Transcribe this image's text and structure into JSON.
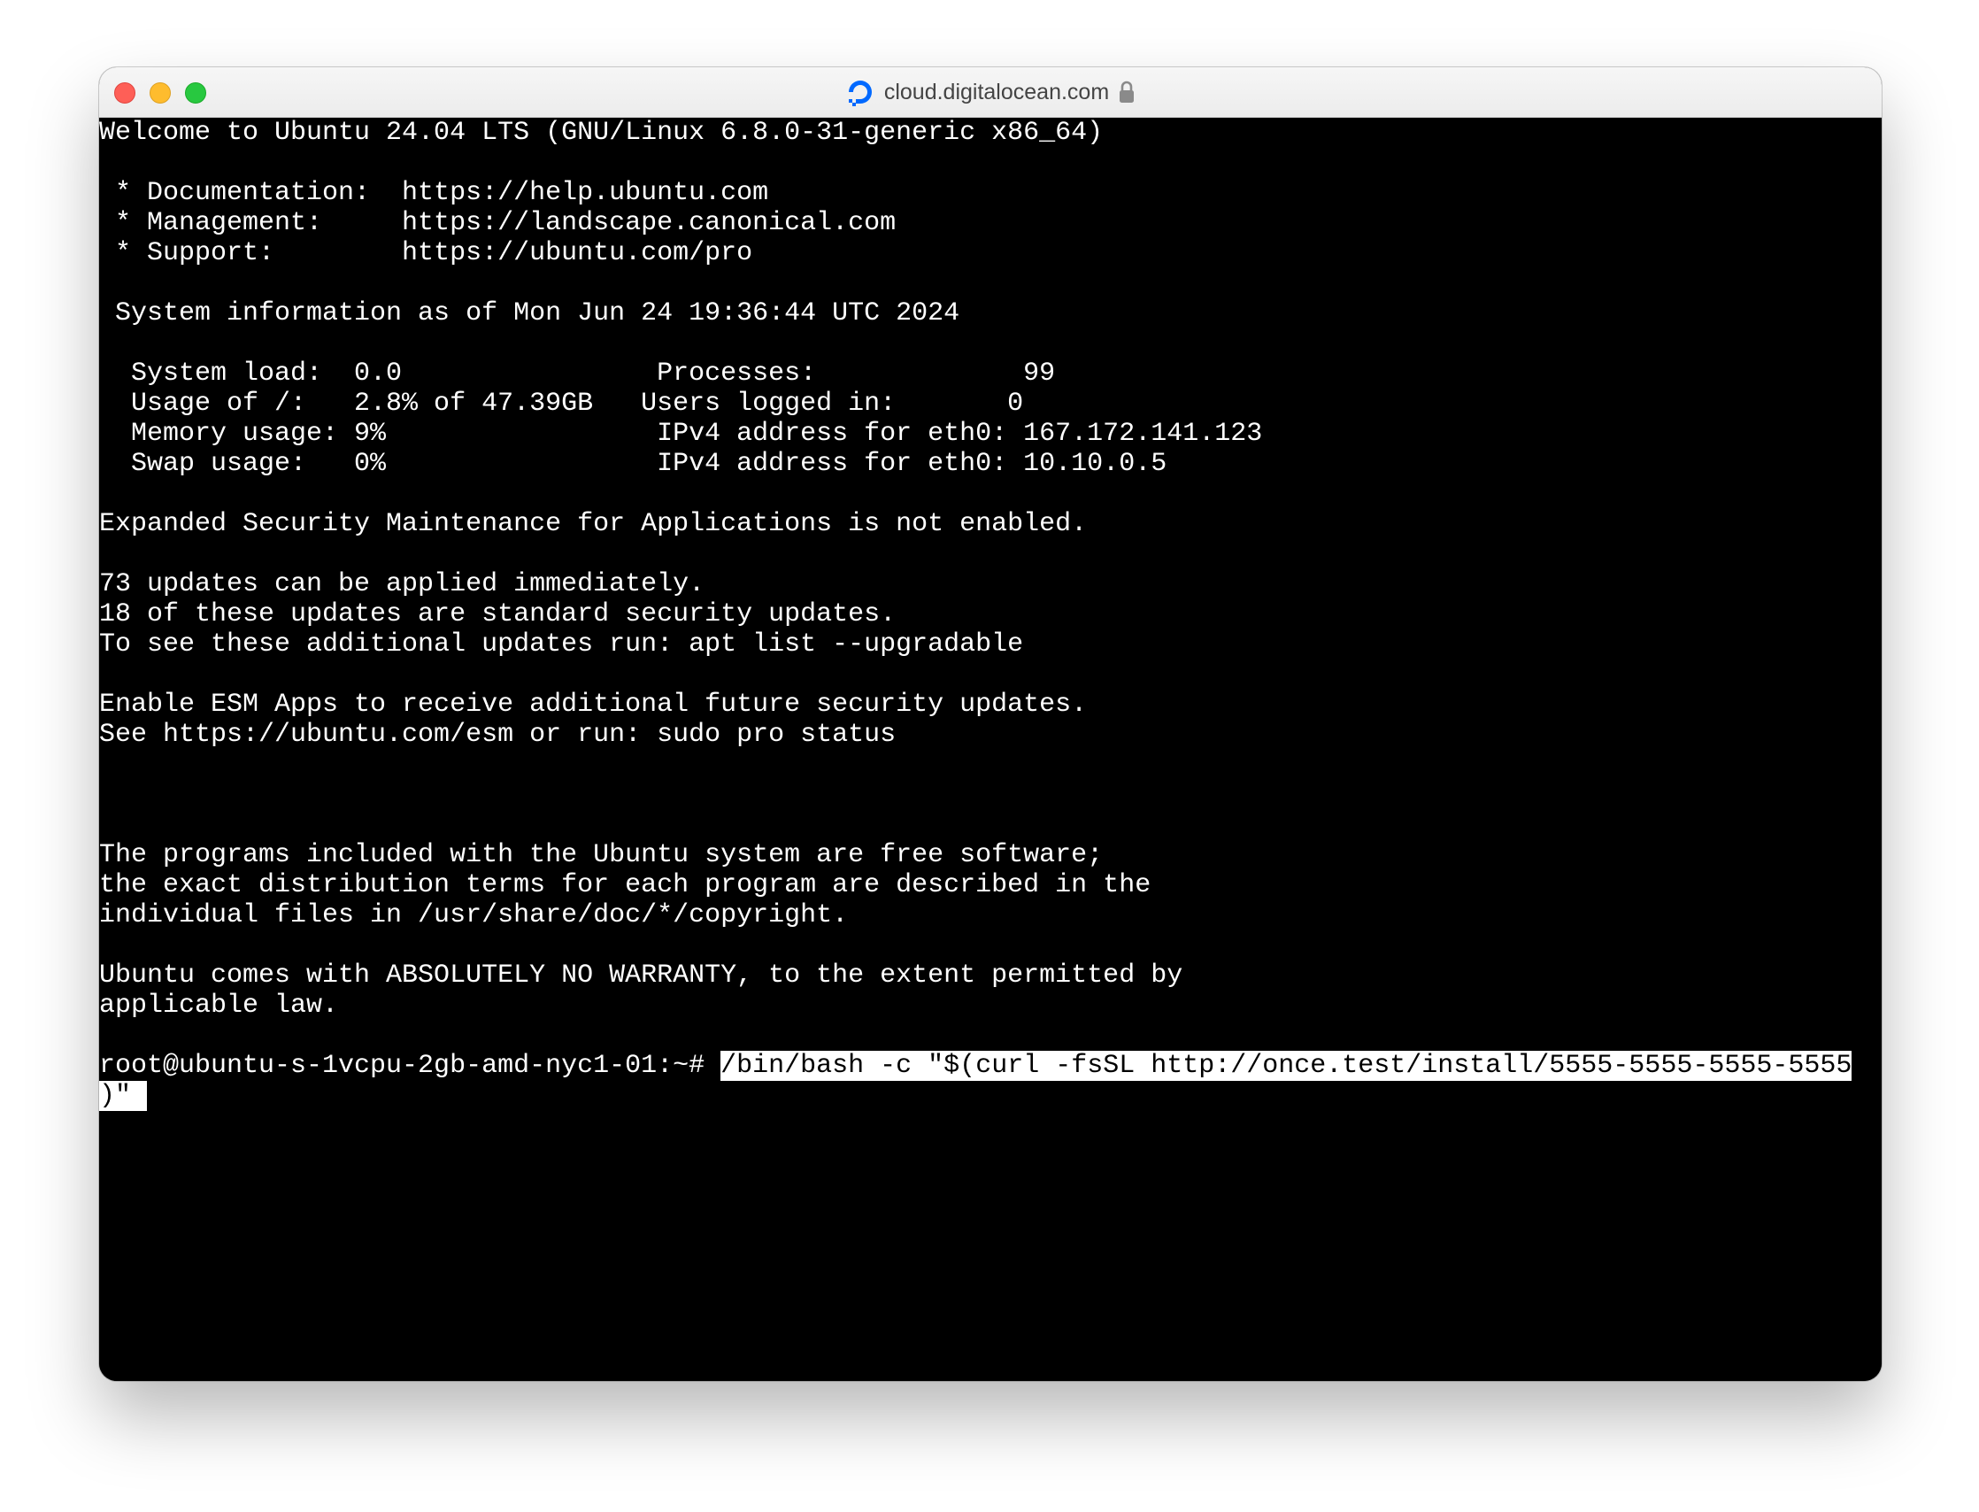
{
  "window": {
    "url": "cloud.digitalocean.com",
    "brand_color": "#0069ff"
  },
  "terminal": {
    "lines": [
      "Welcome to Ubuntu 24.04 LTS (GNU/Linux 6.8.0-31-generic x86_64)",
      "",
      " * Documentation:  https://help.ubuntu.com",
      " * Management:     https://landscape.canonical.com",
      " * Support:        https://ubuntu.com/pro",
      "",
      " System information as of Mon Jun 24 19:36:44 UTC 2024",
      "",
      "  System load:  0.0                Processes:             99",
      "  Usage of /:   2.8% of 47.39GB   Users logged in:       0",
      "  Memory usage: 9%                 IPv4 address for eth0: 167.172.141.123",
      "  Swap usage:   0%                 IPv4 address for eth0: 10.10.0.5",
      "",
      "Expanded Security Maintenance for Applications is not enabled.",
      "",
      "73 updates can be applied immediately.",
      "18 of these updates are standard security updates.",
      "To see these additional updates run: apt list --upgradable",
      "",
      "Enable ESM Apps to receive additional future security updates.",
      "See https://ubuntu.com/esm or run: sudo pro status",
      "",
      "",
      "",
      "The programs included with the Ubuntu system are free software;",
      "the exact distribution terms for each program are described in the",
      "individual files in /usr/share/doc/*/copyright.",
      "",
      "Ubuntu comes with ABSOLUTELY NO WARRANTY, to the extent permitted by",
      "applicable law.",
      ""
    ],
    "prompt": "root@ubuntu-s-1vcpu-2gb-amd-nyc1-01:~#",
    "command_line1": "/bin/bash -c \"$(curl -fsSL http://once.test/install/5555-5555-5555-5555",
    "command_line2": ")\" "
  }
}
